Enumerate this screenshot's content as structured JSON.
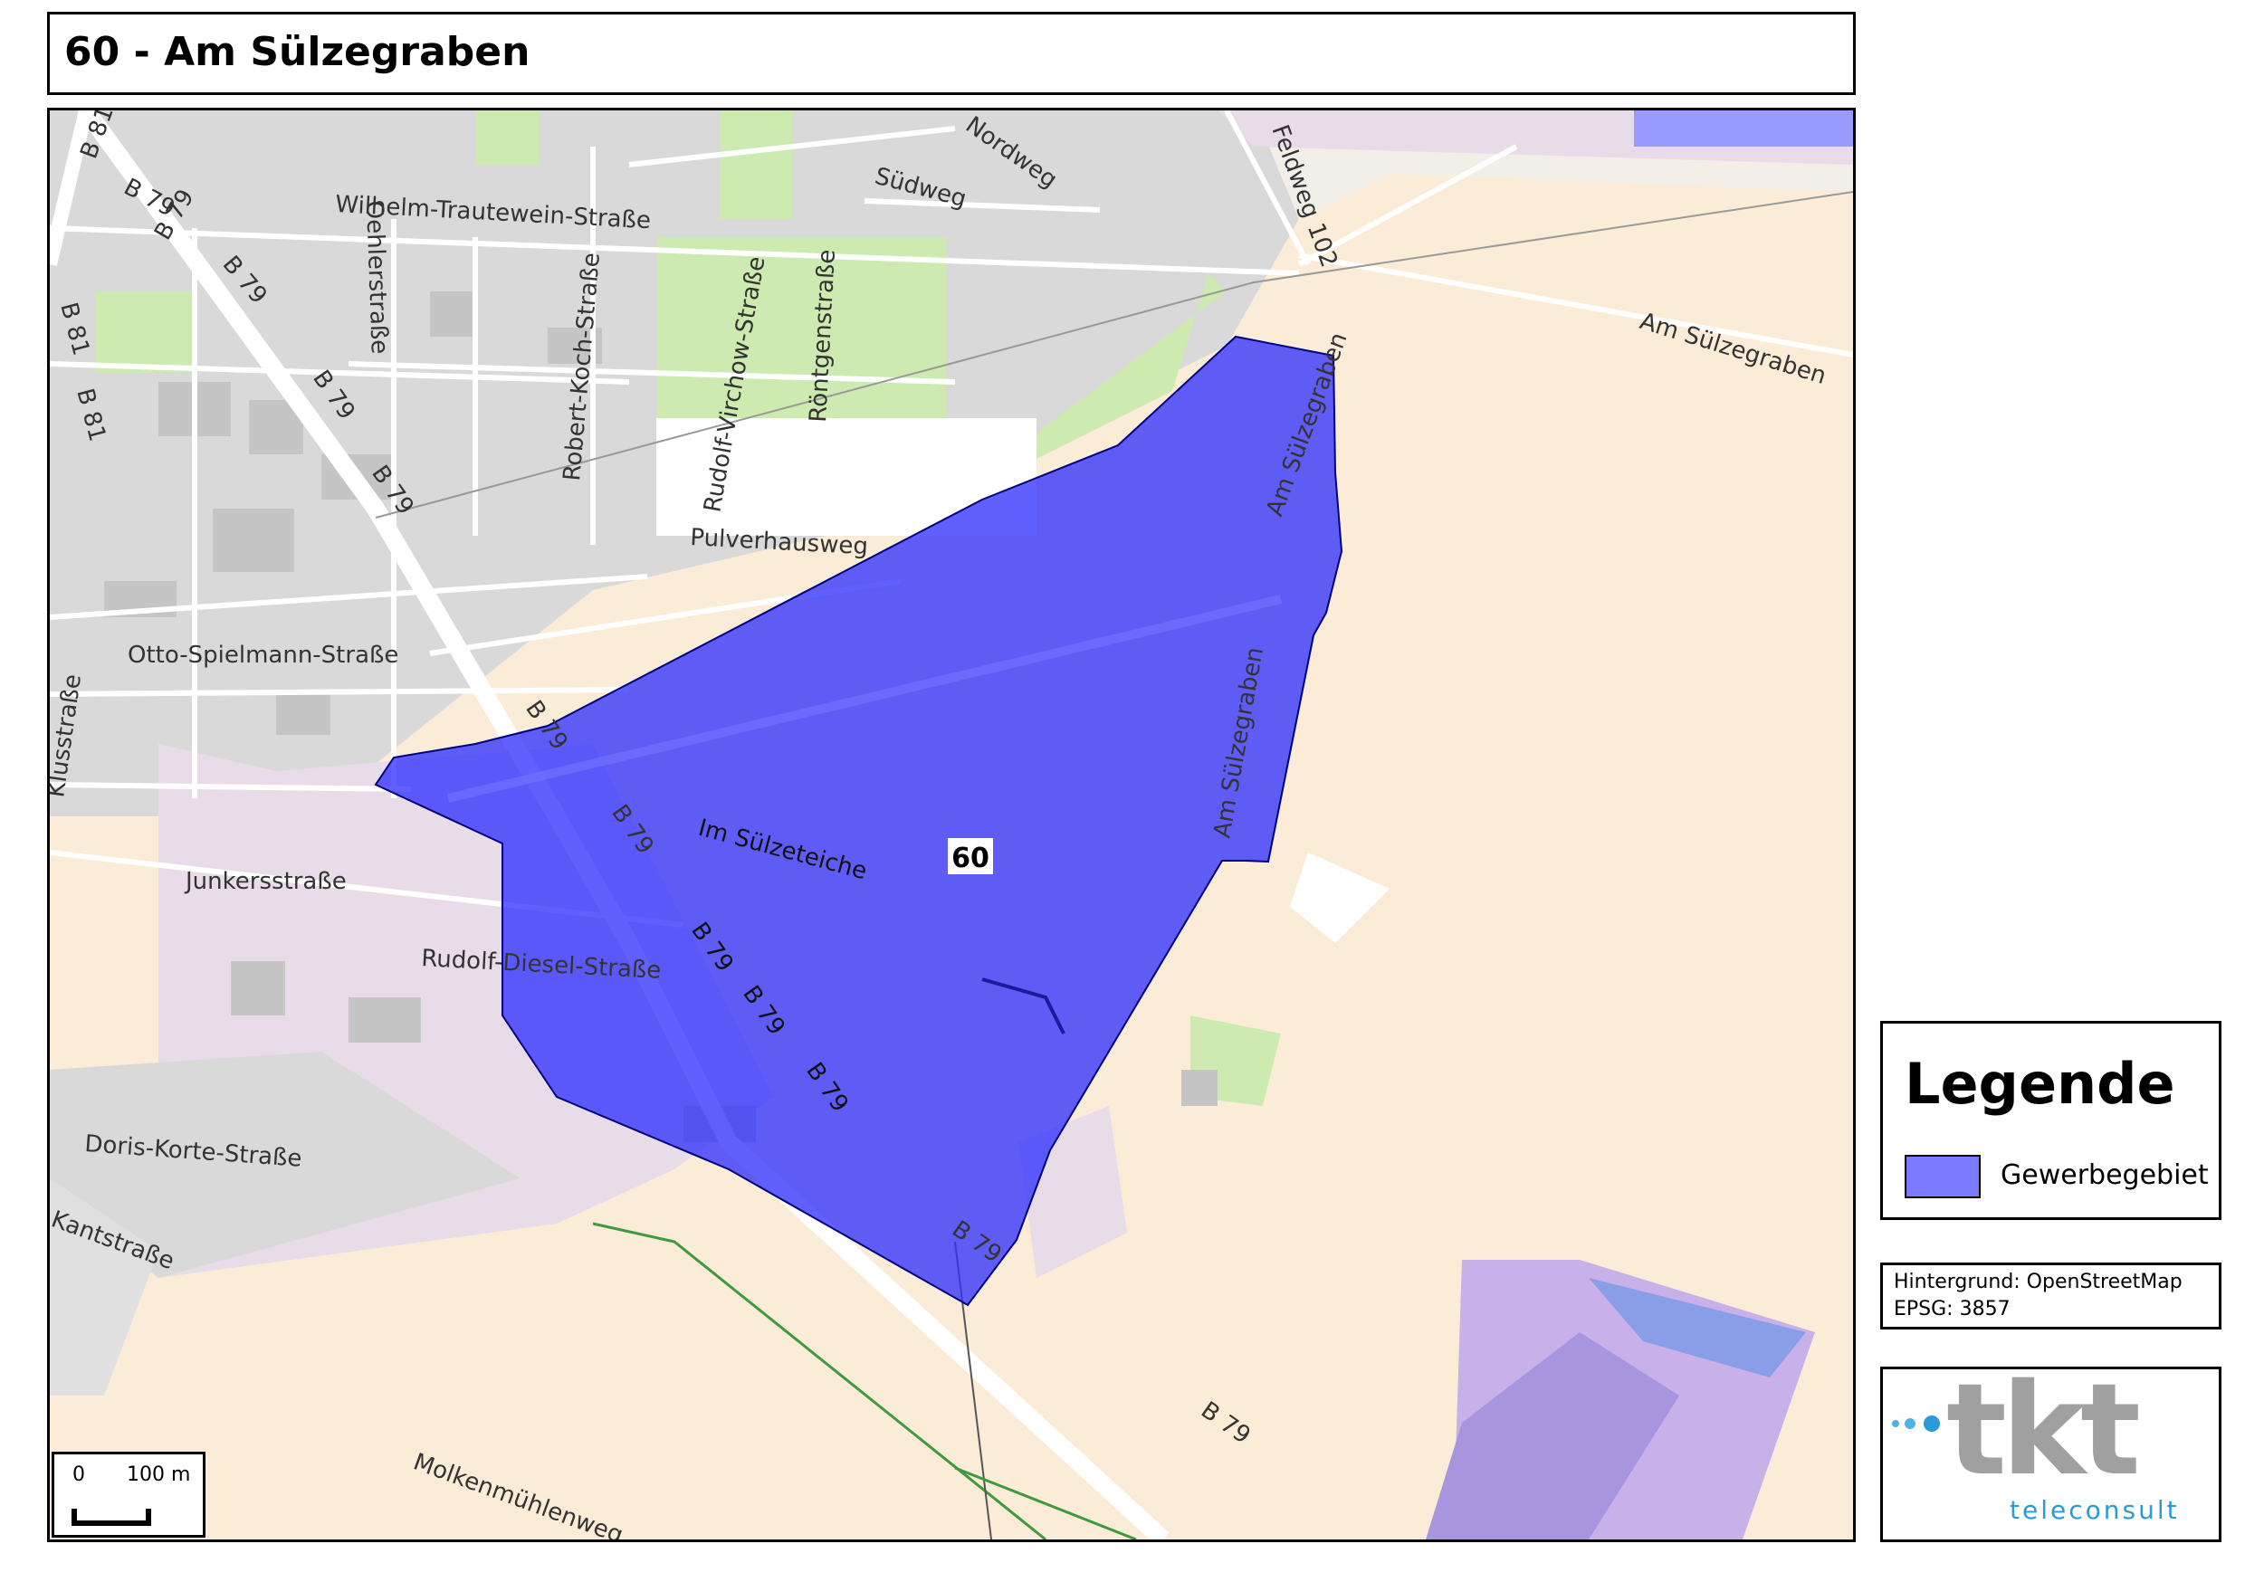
{
  "title": "60 - Am Sülzegraben",
  "colors": {
    "industrial": "#e8dce8",
    "residential": "#d9d9d9",
    "farmland": "#fbecd7",
    "park": "#cdebb0",
    "area_fill": "#3333ff",
    "area_stroke": "#000080",
    "road_major": "#ffffff"
  },
  "map": {
    "area_label": "60",
    "streets": {
      "b81_a": "B 81",
      "b79_a": "B 79",
      "b79_b": "B 79",
      "b79_c": "B 79",
      "b81_b": "B 81",
      "b79_d": "B 79",
      "b79_e": "B 79",
      "b81_c": "B 81",
      "wilhelm": "Wilhelm-Trautewein-Straße",
      "oehler": "Oehlerstraße",
      "robert": "Robert-Koch-Straße",
      "virchow": "Rudolf-Virchow-Straße",
      "roentgen": "Röntgenstraße",
      "sued": "Südweg",
      "nord": "Nordweg",
      "feldweg": "Feldweg 102",
      "am_sue_1": "Am Sülzegraben",
      "am_sue_2": "Am Sülzegraben",
      "am_sue_3": "Am Sülzegraben",
      "pulver": "Pulverhausweg",
      "otto": "Otto-Spielmann-Straße",
      "b79_f": "B 79",
      "kluss": "Klusstraße",
      "b79_g": "B 79",
      "im_suelze": "Im Sülzeteiche",
      "junkers": "Junkersstraße",
      "rudolf_diesel": "Rudolf-Diesel-Straße",
      "b79_h": "B 79",
      "b79_i": "B 79",
      "b79_j": "B 79",
      "doris": "Doris-Korte-Straße",
      "kant": "Kantstraße",
      "b79_k": "B 79",
      "b79_l": "B 79",
      "molken": "Molkenmühlenweg"
    }
  },
  "scalebar": {
    "zero": "0",
    "distance": "100 m"
  },
  "legend": {
    "title": "Legende",
    "item_label": "Gewerbegebiet",
    "item_color": "#7b7bff"
  },
  "source": {
    "background": "Hintergrund: OpenStreetMap",
    "epsg": "EPSG: 3857"
  },
  "logo": {
    "brand": "tkt",
    "sub": "teleconsult"
  }
}
